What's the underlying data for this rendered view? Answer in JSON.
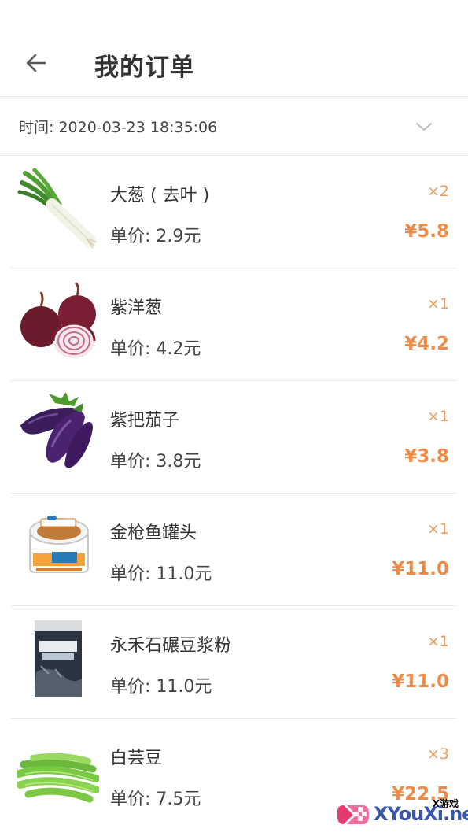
{
  "header": {
    "title": "我的订单",
    "back_icon": "arrow-left-icon"
  },
  "order": {
    "time_text": "时间: 2020-03-23 18:35:06",
    "expand_icon": "chevron-down-icon"
  },
  "items": [
    {
      "name": "大葱 ( 去叶 )",
      "price_text": "单价: 2.9元",
      "qty_text": "×2",
      "total_text": "¥5.8"
    },
    {
      "name": "紫洋葱",
      "price_text": "单价: 4.2元",
      "qty_text": "×1",
      "total_text": "¥4.2"
    },
    {
      "name": "紫把茄子",
      "price_text": "单价: 3.8元",
      "qty_text": "×1",
      "total_text": "¥3.8"
    },
    {
      "name": "金枪鱼罐头",
      "price_text": "单价: 11.0元",
      "qty_text": "×1",
      "total_text": "¥11.0"
    },
    {
      "name": "永禾石碾豆浆粉",
      "price_text": "单价: 11.0元",
      "qty_text": "×1",
      "total_text": "¥11.0"
    },
    {
      "name": "白芸豆",
      "price_text": "单价: 7.5元",
      "qty_text": "×3",
      "total_text": "¥22.5"
    }
  ],
  "watermark": {
    "small_text": "X游戏",
    "main_text": "XYouXi.net"
  },
  "colors": {
    "accent": "#ec8c48",
    "divider": "#e8e8e8"
  }
}
